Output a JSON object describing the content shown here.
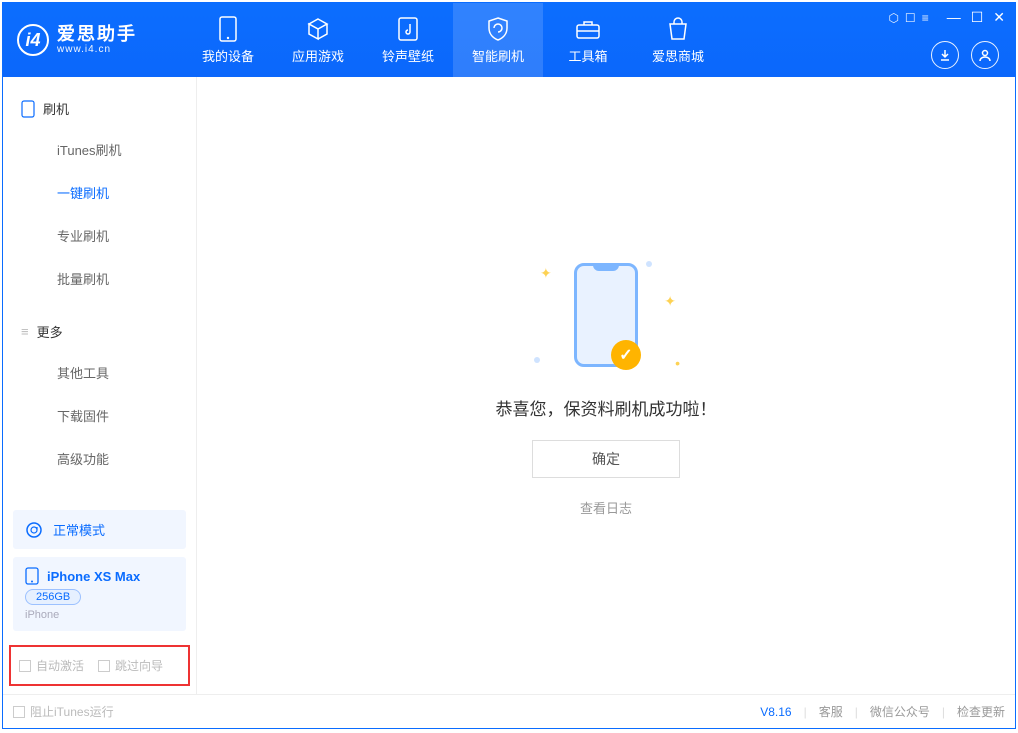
{
  "app": {
    "name_cn": "爱思助手",
    "name_en": "www.i4.cn"
  },
  "header": {
    "tabs": [
      {
        "label": "我的设备"
      },
      {
        "label": "应用游戏"
      },
      {
        "label": "铃声壁纸"
      },
      {
        "label": "智能刷机"
      },
      {
        "label": "工具箱"
      },
      {
        "label": "爱思商城"
      }
    ],
    "active_tab_index": 3
  },
  "sidebar": {
    "section1": {
      "title": "刷机",
      "items": [
        "iTunes刷机",
        "一键刷机",
        "专业刷机",
        "批量刷机"
      ],
      "active_index": 1
    },
    "section2": {
      "title": "更多",
      "items": [
        "其他工具",
        "下载固件",
        "高级功能"
      ]
    },
    "status": {
      "text": "正常模式"
    },
    "device": {
      "name": "iPhone XS Max",
      "capacity": "256GB",
      "type": "iPhone"
    },
    "options": {
      "auto_activate": "自动激活",
      "skip_guide": "跳过向导"
    }
  },
  "main": {
    "success": "恭喜您，保资料刷机成功啦！",
    "confirm": "确定",
    "view_log": "查看日志"
  },
  "footer": {
    "block_itunes": "阻止iTunes运行",
    "version": "V8.16",
    "support": "客服",
    "wechat": "微信公众号",
    "update": "检查更新"
  }
}
